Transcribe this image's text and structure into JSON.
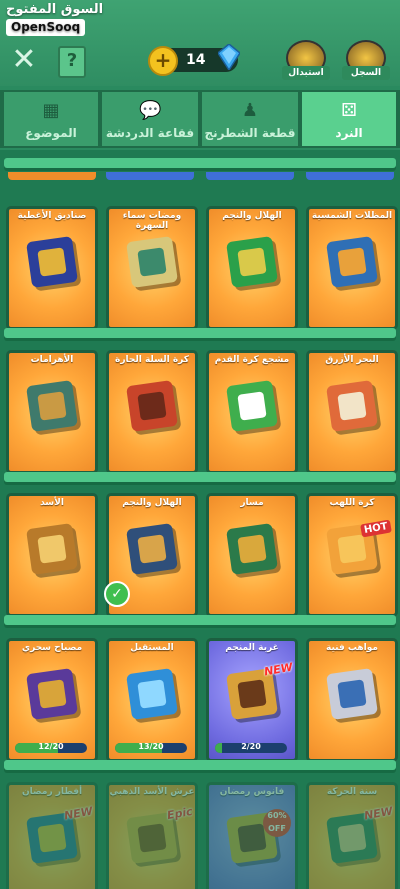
{
  "watermark": {
    "arabic": "السوق المفتوح",
    "latin": "OpenSooq"
  },
  "header": {
    "coins": "14",
    "buttons": [
      {
        "label": "السجل"
      },
      {
        "label": "استبدال"
      }
    ]
  },
  "tabs": [
    {
      "label": "النرد",
      "icon": "dice-icon",
      "active": true
    },
    {
      "label": "قطعة الشطرنج",
      "icon": "chess-piece-icon",
      "active": false
    },
    {
      "label": "فقاعة الدردشة",
      "icon": "chat-bubble-icon",
      "active": false
    },
    {
      "label": "الموضوع",
      "icon": "theme-grid-icon",
      "active": false
    }
  ],
  "rows": [
    [
      {
        "title": "المظلات الشمسية",
        "colors": [
          "#2f6fb5",
          "#e8a13b"
        ]
      },
      {
        "title": "الهلال والنجم",
        "colors": [
          "#2aa04a",
          "#d9c94a"
        ]
      },
      {
        "title": "ومضات سماء السهرة",
        "colors": [
          "#d8c77a",
          "#3c8a6c"
        ]
      },
      {
        "title": "صناديق الأغطية",
        "colors": [
          "#2b3f9a",
          "#e0b23c"
        ]
      }
    ],
    [
      {
        "title": "البحر الأزرق",
        "colors": [
          "#e06a3a",
          "#f2e4c8"
        ]
      },
      {
        "title": "مشجع كرة القدم",
        "colors": [
          "#3fae4d",
          "#ffffff"
        ]
      },
      {
        "title": "كرة السلة الحارة",
        "colors": [
          "#c8442a",
          "#6d2a1a"
        ]
      },
      {
        "title": "الأهرامات",
        "colors": [
          "#3f7a6c",
          "#c99a44"
        ]
      }
    ],
    [
      {
        "title": "كرة اللهب",
        "colors": [
          "#f2a23a",
          "#f7c55a"
        ],
        "badge": "HOT"
      },
      {
        "title": "مسار",
        "colors": [
          "#2b7a4a",
          "#d9a83c"
        ]
      },
      {
        "title": "الهلال والنجم",
        "colors": [
          "#2f4f7a",
          "#d8a44a"
        ],
        "selected": true
      },
      {
        "title": "الأسد",
        "colors": [
          "#b87a2a",
          "#f0c86a"
        ]
      }
    ],
    [
      {
        "title": "مواهب فنية",
        "colors": [
          "#c8ccd8",
          "#3a6fb5"
        ]
      },
      {
        "title": "غربة المنجم",
        "colors": [
          "#d9a13a",
          "#6a3a1a"
        ],
        "badge": "NEW",
        "progress": "2/20",
        "fill": 0.1,
        "purple": true
      },
      {
        "title": "المستقبل",
        "colors": [
          "#2f8fd8",
          "#8fd8ff"
        ],
        "progress": "13/20",
        "fill": 0.65
      },
      {
        "title": "مصباح سحري",
        "colors": [
          "#5a3a9a",
          "#d8a43a"
        ],
        "progress": "12/20",
        "fill": 0.6
      }
    ],
    [
      {
        "title": "سنة الحركة",
        "colors": [
          "#3a7a5a",
          "#d8c08a"
        ],
        "badge": "NEW",
        "dim": true
      },
      {
        "title": "فانوس رمضان",
        "colors": [
          "#c8a23a",
          "#6a3a2a"
        ],
        "badge": "60% OFF",
        "dim": true,
        "purple": true
      },
      {
        "title": "عرش الأسد الذهبي",
        "colors": [
          "#d8a43a",
          "#8a4a1a"
        ],
        "badge": "Epic",
        "dim": true
      },
      {
        "title": "أفطار رمضان",
        "colors": [
          "#2f6f9a",
          "#d8b23a"
        ],
        "badge": "NEW",
        "dim": true
      }
    ]
  ]
}
